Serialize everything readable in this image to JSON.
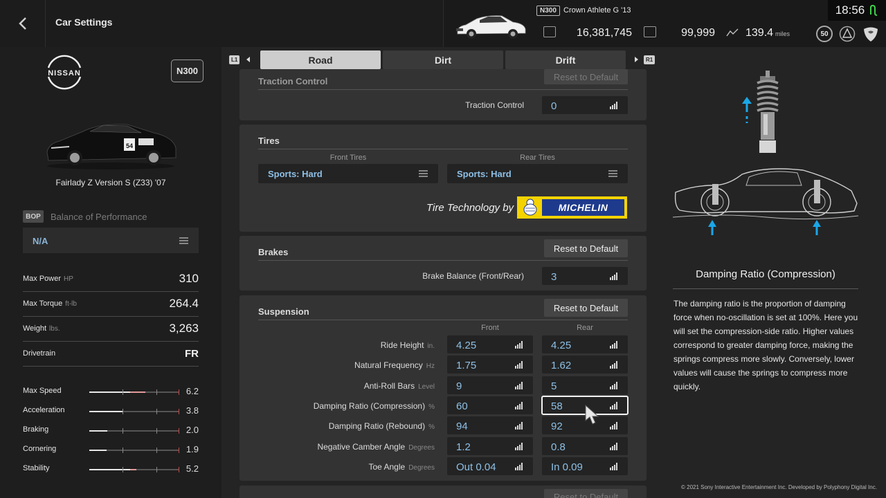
{
  "header": {
    "title": "Car Settings",
    "car_class": "N300",
    "car_name": "Crown Athlete G '13",
    "credits": "16,381,745",
    "mileage_points": "99,999",
    "distance": "139.4",
    "distance_unit": "miles",
    "level": "50",
    "clock": "18:56"
  },
  "left": {
    "brand": "NISSAN",
    "pp_class": "N300",
    "car_model": "Fairlady Z Version S (Z33) '07",
    "bop_tag": "BOP",
    "bop_label": "Balance of Performance",
    "bop_value": "N/A",
    "specs": [
      {
        "label": "Max Power",
        "unit": "HP",
        "value": "310"
      },
      {
        "label": "Max Torque",
        "unit": "ft-lb",
        "value": "264.4"
      },
      {
        "label": "Weight",
        "unit": "lbs.",
        "value": "3,263"
      },
      {
        "label": "Drivetrain",
        "unit": "",
        "value": "FR"
      }
    ],
    "performance": [
      {
        "label": "Max Speed",
        "value": "6.2",
        "level": 0.62
      },
      {
        "label": "Acceleration",
        "value": "3.8",
        "level": 0.38
      },
      {
        "label": "Braking",
        "value": "2.0",
        "level": 0.2
      },
      {
        "label": "Cornering",
        "value": "1.9",
        "level": 0.19
      },
      {
        "label": "Stability",
        "value": "5.2",
        "level": 0.52
      }
    ]
  },
  "tabs": {
    "l1": "L1",
    "r1": "R1",
    "items": [
      "Road",
      "Dirt",
      "Drift"
    ],
    "active": "Road"
  },
  "traction": {
    "title": "Traction Control",
    "reset": "Reset to Default",
    "field_label": "Traction Control",
    "value": "0"
  },
  "tires": {
    "title": "Tires",
    "front_head": "Front Tires",
    "rear_head": "Rear Tires",
    "front_value": "Sports: Hard",
    "rear_value": "Sports: Hard",
    "tech_label": "Tire Technology by",
    "brand": "MICHELIN"
  },
  "brakes": {
    "title": "Brakes",
    "reset": "Reset to Default",
    "field_label": "Brake Balance (Front/Rear)",
    "value": "3"
  },
  "suspension": {
    "title": "Suspension",
    "reset": "Reset to Default",
    "front_head": "Front",
    "rear_head": "Rear",
    "rows": [
      {
        "label": "Ride Height",
        "unit": "in.",
        "front": "4.25",
        "rear": "4.25"
      },
      {
        "label": "Natural Frequency",
        "unit": "Hz",
        "front": "1.75",
        "rear": "1.62"
      },
      {
        "label": "Anti-Roll Bars",
        "unit": "Level",
        "front": "9",
        "rear": "5"
      },
      {
        "label": "Damping Ratio (Compression)",
        "unit": "%",
        "front": "60",
        "rear": "58"
      },
      {
        "label": "Damping Ratio (Rebound)",
        "unit": "%",
        "front": "94",
        "rear": "92"
      },
      {
        "label": "Negative Camber Angle",
        "unit": "Degrees",
        "front": "1.2",
        "rear": "0.8"
      },
      {
        "label": "Toe Angle",
        "unit": "Degrees",
        "front": "Out 0.04",
        "rear": "In 0.09"
      }
    ]
  },
  "next_section": {
    "reset": "Reset to Default"
  },
  "help": {
    "title": "Damping Ratio (Compression)",
    "body": "The damping ratio is the proportion of damping force when no-oscillation is set at 100%. Here you will set the compression-side ratio. Higher values correspond to greater damping force, making the springs compress more slowly. Conversely, lower values will cause the springs to compress more quickly."
  },
  "footer": {
    "copyright": "© 2021 Sony Interactive Entertainment Inc. Developed by Polyphony Digital Inc."
  },
  "colors": {
    "accent_value": "#8ec0e6",
    "active_tab": "#cdcdcd",
    "diagram_arrow": "#1aa7e8"
  }
}
